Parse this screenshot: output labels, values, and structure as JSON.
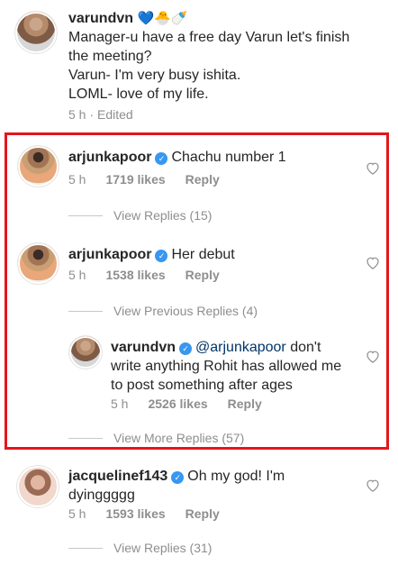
{
  "comments": {
    "top": {
      "username": "varundvn",
      "emojis": "💙🐣🍼",
      "line1": "Manager-u have a free day Varun let's finish",
      "line2": "the meeting?",
      "line3": "Varun- I'm very busy ishita.",
      "line4": "LOML- love of my life.",
      "time": "5 h",
      "edited": "· Edited"
    },
    "c1": {
      "username": "arjunkapoor",
      "text": "Chachu number 1",
      "time": "5 h",
      "likes": "1719 likes",
      "reply": "Reply",
      "view_replies": "View Replies (15)"
    },
    "c2": {
      "username": "arjunkapoor",
      "text": "Her debut",
      "time": "5 h",
      "likes": "1538 likes",
      "reply": "Reply",
      "view_previous": "View Previous Replies (4)"
    },
    "c2_reply": {
      "username": "varundvn",
      "mention": "@arjunkapoor",
      "line1_rest": "don't",
      "line2": "write anything Rohit has allowed me",
      "line3": "to post something after ages",
      "time": "5 h",
      "likes": "2526 likes",
      "reply": "Reply",
      "view_more": "View More Replies (57)"
    },
    "c3": {
      "username": "jacquelinef143",
      "text_line1": "Oh my god! I'm",
      "text_line2": "dyinggggg",
      "time": "5 h",
      "likes": "1593 likes",
      "reply": "Reply",
      "view_replies": "View Replies (31)"
    }
  },
  "verified_glyph": "✓",
  "icons": {
    "like": "heart-outline-icon",
    "verified": "verified-badge-icon"
  },
  "colors": {
    "highlight": "#e3161c",
    "verified": "#3897f0",
    "mention": "#003569",
    "meta": "#8e8e8e"
  }
}
